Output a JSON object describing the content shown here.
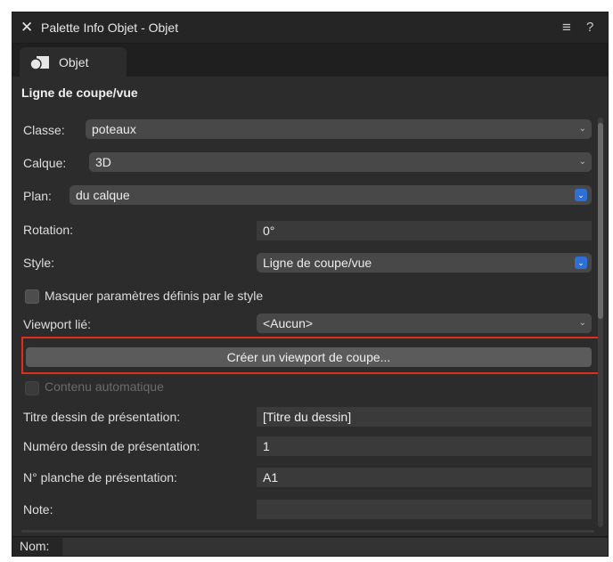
{
  "window": {
    "title": "Palette Info Objet - Objet"
  },
  "tabs": [
    {
      "label": "Objet"
    }
  ],
  "section": {
    "title": "Ligne de coupe/vue"
  },
  "fields": {
    "classe": {
      "label": "Classe:",
      "value": "poteaux"
    },
    "calque": {
      "label": "Calque:",
      "value": "3D"
    },
    "plan": {
      "label": "Plan:",
      "value": "du calque"
    },
    "rotation": {
      "label": "Rotation:",
      "value": "0°"
    },
    "style": {
      "label": "Style:",
      "value": "Ligne de coupe/vue"
    },
    "masquer": {
      "label": "Masquer paramètres définis par le style",
      "checked": false
    },
    "viewport": {
      "label": "Viewport lié:",
      "value": "<Aucun>"
    },
    "create_button": {
      "label": "Créer un viewport de coupe..."
    },
    "contenu_auto": {
      "label": "Contenu automatique",
      "checked": false,
      "disabled": true
    },
    "titre_dessin": {
      "label": "Titre dessin de présentation:",
      "value": "[Titre du dessin]"
    },
    "numero_dessin": {
      "label": "Numéro dessin de présentation:",
      "value": "1"
    },
    "planche": {
      "label": "N° planche de présentation:",
      "value": "A1"
    },
    "note": {
      "label": "Note:",
      "value": ""
    }
  },
  "footer": {
    "name_label": "Nom:",
    "name_value": ""
  },
  "colors": {
    "highlight": "#e02d1f",
    "accent": "#2f6fd6",
    "panel": "#2c2c2c"
  },
  "icons": {
    "close": "close-icon",
    "menu": "menu-icon",
    "help": "help-icon",
    "object": "object-shapes-icon"
  }
}
